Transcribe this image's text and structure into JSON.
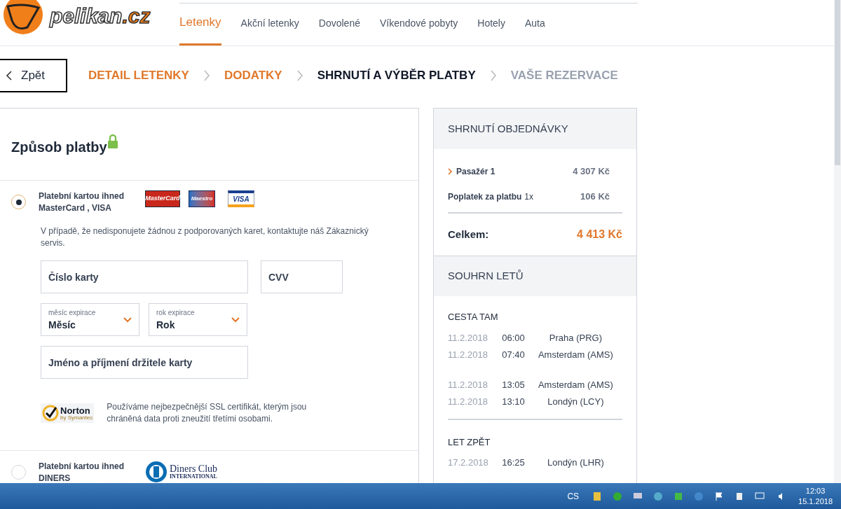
{
  "logo": {
    "text": "pelikan",
    "suffix": ".cz"
  },
  "nav": [
    {
      "label": "Letenky",
      "selected": true
    },
    {
      "label": "Akční letenky",
      "selected": false
    },
    {
      "label": "Dovolené",
      "selected": false
    },
    {
      "label": "Víkendové pobyty",
      "selected": false
    },
    {
      "label": "Hotely",
      "selected": false
    },
    {
      "label": "Auta",
      "selected": false
    }
  ],
  "back_button": {
    "label": "Zpět"
  },
  "steps": [
    {
      "label": "DETAIL LETENKY",
      "kind": "done"
    },
    {
      "label": "DODATKY",
      "kind": "done"
    },
    {
      "label": "SHRNUTÍ A VÝBĚR PLATBY",
      "kind": "current"
    },
    {
      "label": "VAŠE REZERVACE",
      "kind": "upcoming"
    }
  ],
  "payment": {
    "title": "Způsob platby",
    "methods": [
      {
        "label": "Platební kartou ihned",
        "brands": "MasterCard , VISA",
        "selected": true,
        "logos": [
          {
            "kind": "mastercard",
            "text": "MasterCard"
          },
          {
            "kind": "maestro",
            "text": "Maestro"
          },
          {
            "kind": "visa",
            "text": "VISA"
          }
        ]
      },
      {
        "label": "Platební kartou ihned",
        "brands": "DINERS",
        "selected": false,
        "logos": [
          {
            "kind": "diners",
            "text": "Diners Club",
            "subtext": "INTERNATIONAL"
          }
        ]
      }
    ],
    "note": "V případě, že nedisponujete žádnou z podporovaných karet, kontaktujte náš Zákaznický servis.",
    "card_number": {
      "placeholder": "Číslo karty"
    },
    "cvv": {
      "placeholder": "CVV"
    },
    "month": {
      "label": "měsíc expirace",
      "value": "Měsíc"
    },
    "year": {
      "label": "rok expirace",
      "value": "Rok"
    },
    "holder": {
      "placeholder": "Jméno a příjmení držitele karty"
    },
    "norton": {
      "text": "Norton",
      "subtext": "by Symantec"
    },
    "security_note": "Používáme nejbezpečnější SSL certifikát, kterým jsou chráněná data proti zneužití třetími osobami."
  },
  "order_summary": {
    "title": "SHRNUTÍ OBJEDNÁVKY",
    "rows": [
      {
        "label": "Pasažér 1",
        "expandable": true,
        "price": "4 307 Kč"
      },
      {
        "label": "Poplatek za platbu",
        "qty": "1x",
        "expandable": false,
        "price": "106 Kč"
      }
    ],
    "total_label": "Celkem:",
    "total": "4 413 Kč"
  },
  "flights": {
    "title": "SOUHRN LETŮ",
    "legs": [
      {
        "title": "CESTA TAM",
        "segments": [
          [
            {
              "date": "11.2.2018",
              "time": "06:00",
              "place": "Praha (PRG)"
            },
            {
              "date": "11.2.2018",
              "time": "07:40",
              "place": "Amsterdam (AMS)"
            }
          ],
          [
            {
              "date": "11.2.2018",
              "time": "13:05",
              "place": "Amsterdam (AMS)"
            },
            {
              "date": "11.2.2018",
              "time": "13:10",
              "place": "Londýn (LCY)"
            }
          ]
        ]
      },
      {
        "title": "LET ZPĚT",
        "segments": [
          [
            {
              "date": "17.2.2018",
              "time": "16:25",
              "place": "Londýn (LHR)"
            }
          ]
        ]
      }
    ]
  },
  "taskbar": {
    "language": "CS",
    "time": "12:03",
    "date": "15.1.2018"
  }
}
